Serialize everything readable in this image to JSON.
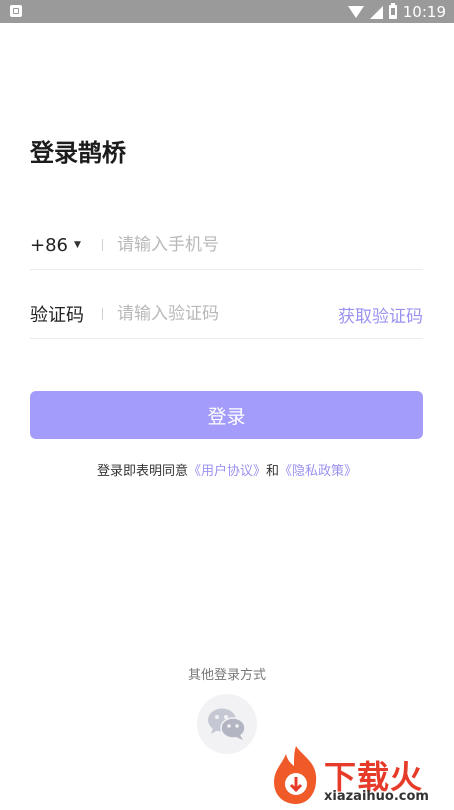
{
  "status_bar": {
    "time": "10:19"
  },
  "page": {
    "title": "登录鹊桥"
  },
  "phone_row": {
    "country_code": "+86",
    "placeholder": "请输入手机号"
  },
  "code_row": {
    "label": "验证码",
    "placeholder": "请输入验证码",
    "get_code": "获取验证码"
  },
  "login_button": "登录",
  "agreement": {
    "prefix": "登录即表明同意",
    "user_agreement": "《用户协议》",
    "and": "和",
    "privacy_policy": "《隐私政策》"
  },
  "other_login": {
    "label": "其他登录方式",
    "wechat_icon": "wechat-icon"
  },
  "watermark": {
    "title": "下载火",
    "subtitle": "xiazaihuo.com"
  },
  "colors": {
    "accent": "#a49cfa",
    "link": "#9a92f0",
    "status_bar": "#9a9a9a",
    "watermark": "#e73b2a"
  }
}
